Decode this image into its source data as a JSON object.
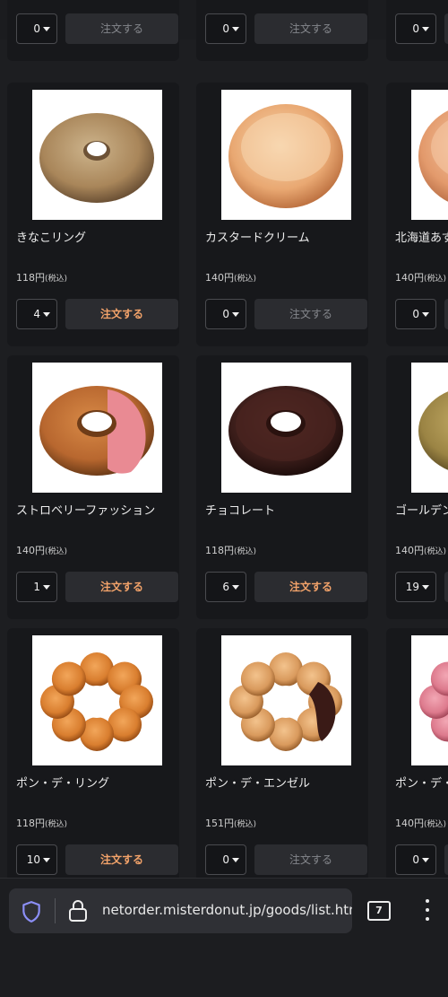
{
  "products": [
    {
      "qty": "0",
      "button": "注文する",
      "enabled": false
    },
    {
      "qty": "0",
      "button": "注文する",
      "enabled": false
    },
    {
      "qty": "0",
      "button": "",
      "enabled": false
    },
    {
      "name": "きなこリング",
      "price": "118円",
      "tax": "(税込)",
      "qty": "4",
      "button": "注文する",
      "enabled": true,
      "donut": "kinako"
    },
    {
      "name": "カスタードクリーム",
      "price": "140円",
      "tax": "(税込)",
      "qty": "0",
      "button": "注文する",
      "enabled": false,
      "donut": "custard"
    },
    {
      "name": "北海道あず",
      "price": "140円",
      "tax": "(税込)",
      "qty": "0",
      "button": "",
      "enabled": false,
      "donut": "hokkaido"
    },
    {
      "name": "ストロベリーファッション",
      "price": "140円",
      "tax": "(税込)",
      "qty": "1",
      "button": "注文する",
      "enabled": true,
      "donut": "strawberry"
    },
    {
      "name": "チョコレート",
      "price": "118円",
      "tax": "(税込)",
      "qty": "6",
      "button": "注文する",
      "enabled": true,
      "donut": "chocolate"
    },
    {
      "name": "ゴールデン",
      "price": "140円",
      "tax": "(税込)",
      "qty": "19",
      "button": "",
      "enabled": true,
      "donut": "golden"
    },
    {
      "name": "ポン・デ・リング",
      "price": "118円",
      "tax": "(税込)",
      "qty": "10",
      "button": "注文する",
      "enabled": true,
      "donut": "pondering"
    },
    {
      "name": "ポン・デ・エンゼル",
      "price": "151円",
      "tax": "(税込)",
      "qty": "0",
      "button": "注文する",
      "enabled": false,
      "donut": "angel"
    },
    {
      "name": "ポン・デ・",
      "price": "140円",
      "tax": "(税込)",
      "qty": "0",
      "button": "",
      "enabled": false,
      "donut": "pink"
    }
  ],
  "browser": {
    "url": "netorder.misterdonut.jp/goods/list.html",
    "tab_count": "7",
    "shield_icon": "shield-icon",
    "lock_icon": "lock-icon",
    "menu_icon": "more-vertical-icon",
    "accent_color": "#f3a36a"
  }
}
